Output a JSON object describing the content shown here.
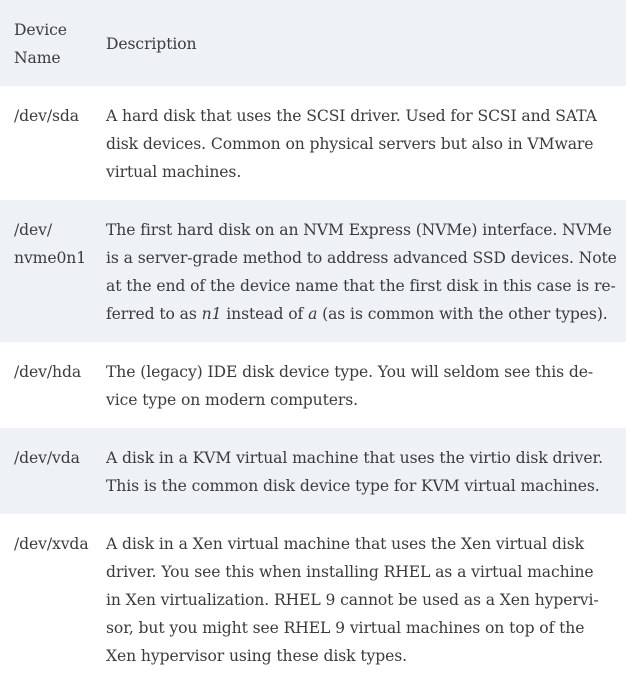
{
  "table": {
    "headers": {
      "name_line1": "Device",
      "name_line2": "Name",
      "description": "Description"
    },
    "rows": [
      {
        "name_lines": [
          "/dev/sda"
        ],
        "desc_lines": [
          "A hard disk that uses the SCSI driver. Used for SCSI and SATA",
          "disk devices. Common on physical servers but also in VMware",
          "virtual machines."
        ]
      },
      {
        "name_lines": [
          "/dev/",
          "nvme0n1"
        ],
        "desc_lines": [
          "The first hard disk on an NVM Express (NVMe) interface. NVMe",
          "is a server-grade method to address advanced SSD devices. Note",
          "at the end of the device name that the first disk in this case is re-"
        ],
        "desc_last_pre": "ferred to as ",
        "desc_last_em1": "n1",
        "desc_last_mid": " instead of ",
        "desc_last_em2": "a",
        "desc_last_post": " (as is common with the other types)."
      },
      {
        "name_lines": [
          "/dev/hda"
        ],
        "desc_lines": [
          "The (legacy) IDE disk device type. You will seldom see this de-",
          "vice type on modern computers."
        ]
      },
      {
        "name_lines": [
          "/dev/vda"
        ],
        "desc_lines": [
          "A disk in a KVM virtual machine that uses the virtio disk driver.",
          "This is the common disk device type for KVM virtual machines."
        ]
      },
      {
        "name_lines": [
          "/dev/xvda"
        ],
        "desc_lines": [
          "A disk in a Xen virtual machine that uses the Xen virtual disk",
          "driver. You see this when installing RHEL as a virtual machine",
          "in Xen virtualization. RHEL 9 cannot be used as a Xen hypervi-",
          "sor, but you might see RHEL 9 virtual machines on top of the",
          "Xen hypervisor using these disk types."
        ]
      }
    ]
  }
}
